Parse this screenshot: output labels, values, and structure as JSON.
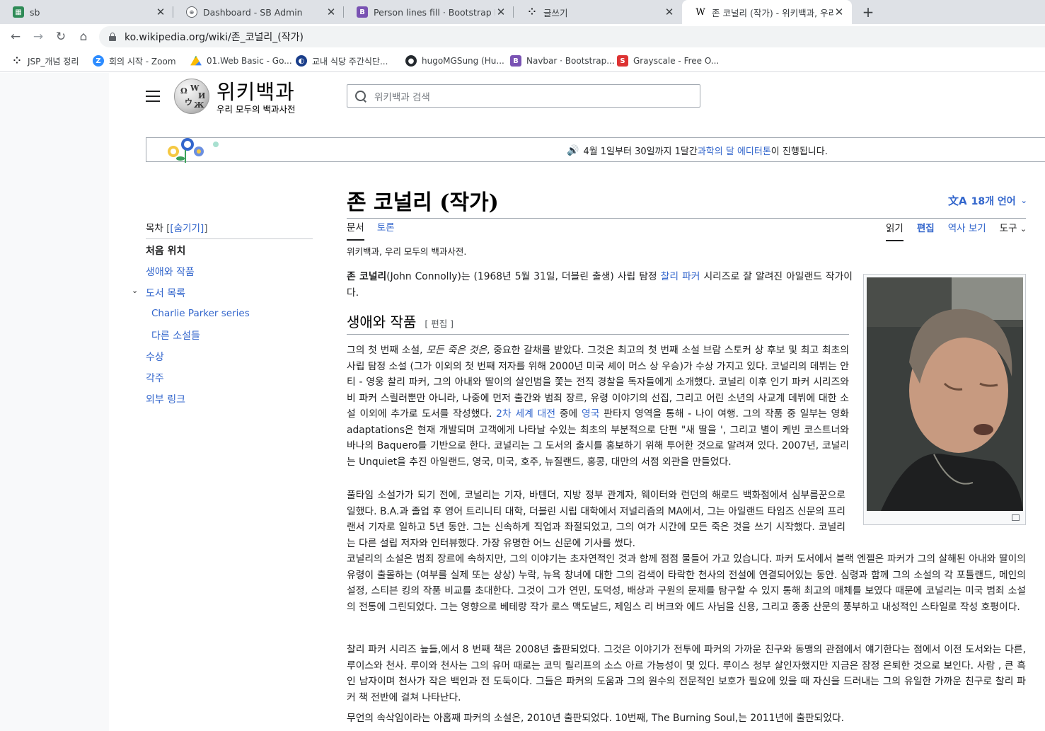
{
  "browser": {
    "tabs": [
      {
        "title": "sb",
        "icon": "sb-favicon",
        "color": "#2f8b57"
      },
      {
        "title": "Dashboard - SB Admin",
        "icon": "globe-icon",
        "color": "#5f6368"
      },
      {
        "title": "Person lines fill · Bootstrap Icon",
        "icon": "bootstrap-icon",
        "color": "#7952b3"
      },
      {
        "title": "글쓰기",
        "icon": "dots-icon",
        "color": "#202124"
      },
      {
        "title": "존 코널리 (작가) - 위키백과, 우리",
        "icon": "wikipedia-icon",
        "color": "#000000",
        "active": true
      }
    ],
    "url": "ko.wikipedia.org/wiki/존_코널리_(작가)",
    "bookmarks": [
      {
        "label": "JSP_개념 정리",
        "icon": "dots-icon",
        "color": "#202124"
      },
      {
        "label": "회의 시작 - Zoom",
        "icon": "zoom-icon",
        "color": "#2d8cff"
      },
      {
        "label": "01.Web Basic - Go...",
        "icon": "drive-icon",
        "color": "#fbbc04"
      },
      {
        "label": "교내 식당 주간식단...",
        "icon": "school-icon",
        "color": "#1a3e8a"
      },
      {
        "label": "hugoMGSung (Hu...",
        "icon": "github-icon",
        "color": "#24292e"
      },
      {
        "label": "Navbar · Bootstrap...",
        "icon": "bootstrap-icon",
        "color": "#7952b3"
      },
      {
        "label": "Grayscale - Free O...",
        "icon": "startbootstrap-icon",
        "color": "#dd3333"
      }
    ]
  },
  "wiki": {
    "wordmark": "위키백과",
    "tagline": "우리 모두의 백과사전",
    "search_placeholder": "위키백과 검색",
    "banner": {
      "pre": "4월 1일부터 30일까지 1달간 ",
      "link": "과학의 달 에디터톤",
      "post": "이 진행됩니다."
    },
    "title": "존 코널리 (작가)",
    "languages": "18개 언어",
    "tabs_left": [
      "문서",
      "토론"
    ],
    "tabs_right": [
      "읽기",
      "편집",
      "역사 보기",
      "도구"
    ],
    "site_sub": "위키백과, 우리 모두의 백과사전.",
    "toc": {
      "title": "목차",
      "hide": "[숨기기]",
      "items": [
        "처음 위치",
        "생애와 작품",
        "도서 목록",
        "Charlie Parker series",
        "다른 소설들",
        "수상",
        "각주",
        "외부 링크"
      ]
    },
    "intro": {
      "bold": "존 코널리",
      "a": "(John Connolly)는 (1968년 5월 31일, 더블린 출생) 사립 탐정 ",
      "link": "찰리 파커",
      "b": " 시리즈로 잘 알려진 아일랜드 작가이다."
    },
    "section_title": "생애와 작품",
    "section_edit": "[ 편집 ]",
    "p1": {
      "a": "그의 첫 번째 소설, ",
      "italic": "모든 죽은 것은",
      "b": ", 중요한 갈채를 받았다. 그것은 최고의 첫 번째 소설 브람 스토커 상 후보 및 최고 최초의 사립 탐정 소설 (그가 이외의 첫 번째 저자를 위해 2000년 미국 셰이 머스 상 우승)가 수상 가지고 있다. 코널리의 데뷔는 안티 - 영웅 찰리 파커, 그의 아내와 딸이의 살인범을 쫓는 전직 경찰을 독자들에게 소개했다. 코널리 이후 인기 파커 시리즈와 비 파커 스릴러뿐만 아니라, 나중에 먼저 출간와 범죄 장르, 유령 이야기의 선집, 그리고 어린 소년의 사교계 데뷔에 대한 소설 이외에 추가로 도서를 작성했다. ",
      "link1": "2차 세계 대전",
      "c": " 중에 ",
      "link2": "영국",
      "d": " 판타지 영역을 통해 - 나이 여행. 그의 작품 중 일부는 영화 adaptations은 현재 개발되며 고객에게 나타날 수있는 최초의 부분적으로 단편 \"새 딸을 ', 그리고 별이 케빈 코스트너와 바나의 Baquero를 기반으로 한다. 코널리는 그 도서의 출시를 홍보하기 위해 투어한 것으로 알려져 있다. 2007년, 코널리는 Unquiet을 추진 아일랜드, 영국, 미국, 호주, 뉴질랜드, 홍콩, 대만의 서점 외관을 만들었다."
    },
    "p2": "풀타임 소설가가 되기 전에, 코널리는 기자, 바텐더, 지방 정부 관계자, 웨이터와 런던의 해로드 백화점에서 심부름꾼으로 일했다. B.A.과 졸업 후 영어 트리니티 대학, 더블린 시립 대학에서 저널리즘의 MA에서, 그는 아일랜드 타임즈 신문의 프리랜서 기자로 일하고 5년 동안. 그는 신속하게 직업과 좌절되었고, 그의 여가 시간에 모든 죽은 것을 쓰기 시작했다. 코널리는 다른 설립 저자와 인터뷰했다. 가장 유명한 어느 신문에 기사를 썼다.",
    "p3": "코널리의 소설은 범죄 장르에 속하지만, 그의 이야기는 초자연적인 것과 함께 점점 물들어 가고 있습니다. 파커 도서에서 블랙 엔젤은 파커가 그의 살해된 아내와 딸이의 유령이 출몰하는 (여부를 실제 또는 상상) 누락, 뉴욕 창녀에 대한 그의 검색이 타락한 천사의 전설에 연결되어있는 동안. 심령과 함께 그의 소설의 각 포틀랜드, 메인의 설정, 스티븐 킹의 작품 비교를 초대한다. 그것이 그가 연민, 도덕성, 배상과 구원의 문제를 탐구할 수 있지 통해 최고의 매체를 보였다 때문에 코널리는 미국 범죄 소설의 전통에 그린되었다. 그는 영향으로 베테랑 작가 로스 맥도날드, 제임스 리 버크와 에드 사님을 신용, 그리고 종종 산문의 풍부하고 내성적인 스타일로 작성 호평이다.",
    "p4": "찰리 파커 시리즈 늪들,에서 8 번째 책은 2008년 출판되었다. 그것은 이야기가 전투에 파커의 가까운 친구와 동맹의 관점에서 얘기한다는 점에서 이전 도서와는 다른, 루이스와 천사. 루이와 천사는 그의 유머 때로는 코믹 릴리프의 소스 아르 가능성이 몇 있다. 루이스 청부 살인자했지만 지금은 잠정 은퇴한 것으로 보인다. 사람 , 큰 흑인 남자이며 천사가 작은 백인과 전 도둑이다. 그들은 파커의 도움과 그의 원수의 전문적인 보호가 필요에 있을 때 자신을 드러내는 그의 유일한 가까운 친구로 찰리 파커 책 전반에 걸쳐 나타난다.",
    "p5": "무언의 속삭임이라는 아홉째 파커의 소설은, 2010년 출판되었다. 10번째, The Burning Soul,는 2011년에 출판되었다."
  },
  "colors": {
    "link": "#3366cc",
    "text": "#202122",
    "border": "#a2a9b1",
    "chrome_tabbar": "#dee1e6"
  }
}
